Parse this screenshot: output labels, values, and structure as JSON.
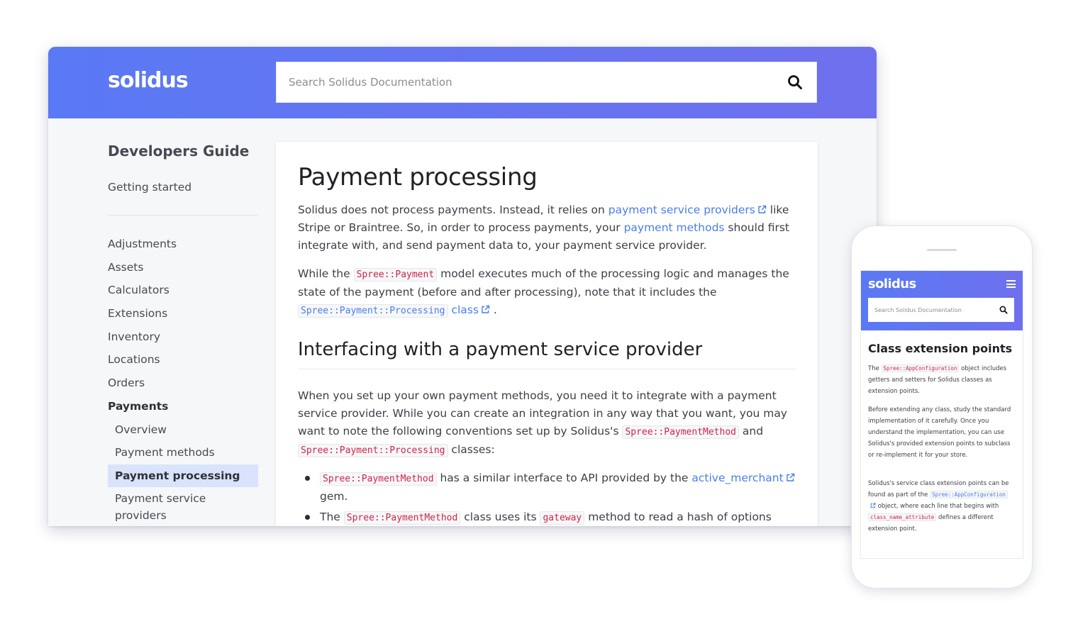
{
  "desktop": {
    "logo": "solidus",
    "search": {
      "placeholder": "Search Solidus Documentation"
    },
    "sidebar": {
      "title": "Developers Guide",
      "getting_started": "Getting started",
      "items": [
        {
          "label": "Adjustments"
        },
        {
          "label": "Assets"
        },
        {
          "label": "Calculators"
        },
        {
          "label": "Extensions"
        },
        {
          "label": "Inventory"
        },
        {
          "label": "Locations"
        },
        {
          "label": "Orders"
        },
        {
          "label": "Payments"
        },
        {
          "label": "Overview"
        },
        {
          "label": "Payment methods"
        },
        {
          "label": "Payment processing"
        },
        {
          "label": "Payment service providers"
        }
      ]
    },
    "content": {
      "title": "Payment processing",
      "p1": {
        "t1": "Solidus does not process payments. Instead, it relies on ",
        "link1": "payment service providers",
        "t2": " like Stripe or Braintree. So, in order to process payments, your ",
        "link2": "payment methods",
        "t3": " should first integrate with, and send payment data to, your payment service provider."
      },
      "p2": {
        "t1": "While the ",
        "code1": "Spree::Payment",
        "t2": " model executes much of the processing logic and manages the state of the payment (before and after processing), note that it includes the ",
        "code2": "Spree::Payment::Processing",
        "link": "class",
        "t3": " ."
      },
      "h2": "Interfacing with a payment service provider",
      "p3": {
        "t1": "When you set up your own payment methods, you need it to integrate with a payment service provider. While you can create an integration in any way that you want, you may want to note the following conventions set up by Solidus's ",
        "code1": "Spree::PaymentMethod",
        "t2": " and ",
        "code2": "Spree::Payment::Processing",
        "t3": " classes:"
      },
      "bullets": [
        {
          "code": "Spree::PaymentMethod",
          "t1": " has a similar interface to API provided by the ",
          "link": "active_merchant",
          "t2": " gem."
        },
        {
          "t0": "The ",
          "code": "Spree::PaymentMethod",
          "t1": " class uses its ",
          "code2": "gateway",
          "t2": " method to read a hash of options that"
        }
      ]
    }
  },
  "mobile": {
    "logo": "solidus",
    "search": {
      "placeholder": "Search Solidus Documentation"
    },
    "content": {
      "title": "Class extension points",
      "p1": {
        "t1": "The ",
        "code1": "Spree::AppConfiguration",
        "t2": " object includes getters and setters for Solidus classes as extension points."
      },
      "p2": "Before extending any class, study the standard implementation of it carefully. Once you understand the implementation, you can use Solidus's provided extension points to subclass or re-implement it for your store.",
      "p3": {
        "t1": "Solidus's service class extension points can be found as part of the ",
        "code1": "Spree::AppConfiguration",
        "t2": " object, where each line that begins with ",
        "code2": "class_name_attribute",
        "t3": " defines a different extension point."
      }
    }
  },
  "colors": {
    "header_start": "#5a79f4",
    "header_end": "#6f70ee",
    "link": "#4a7ee8",
    "code": "#d0264a",
    "active_bg": "#d9e3fb"
  }
}
